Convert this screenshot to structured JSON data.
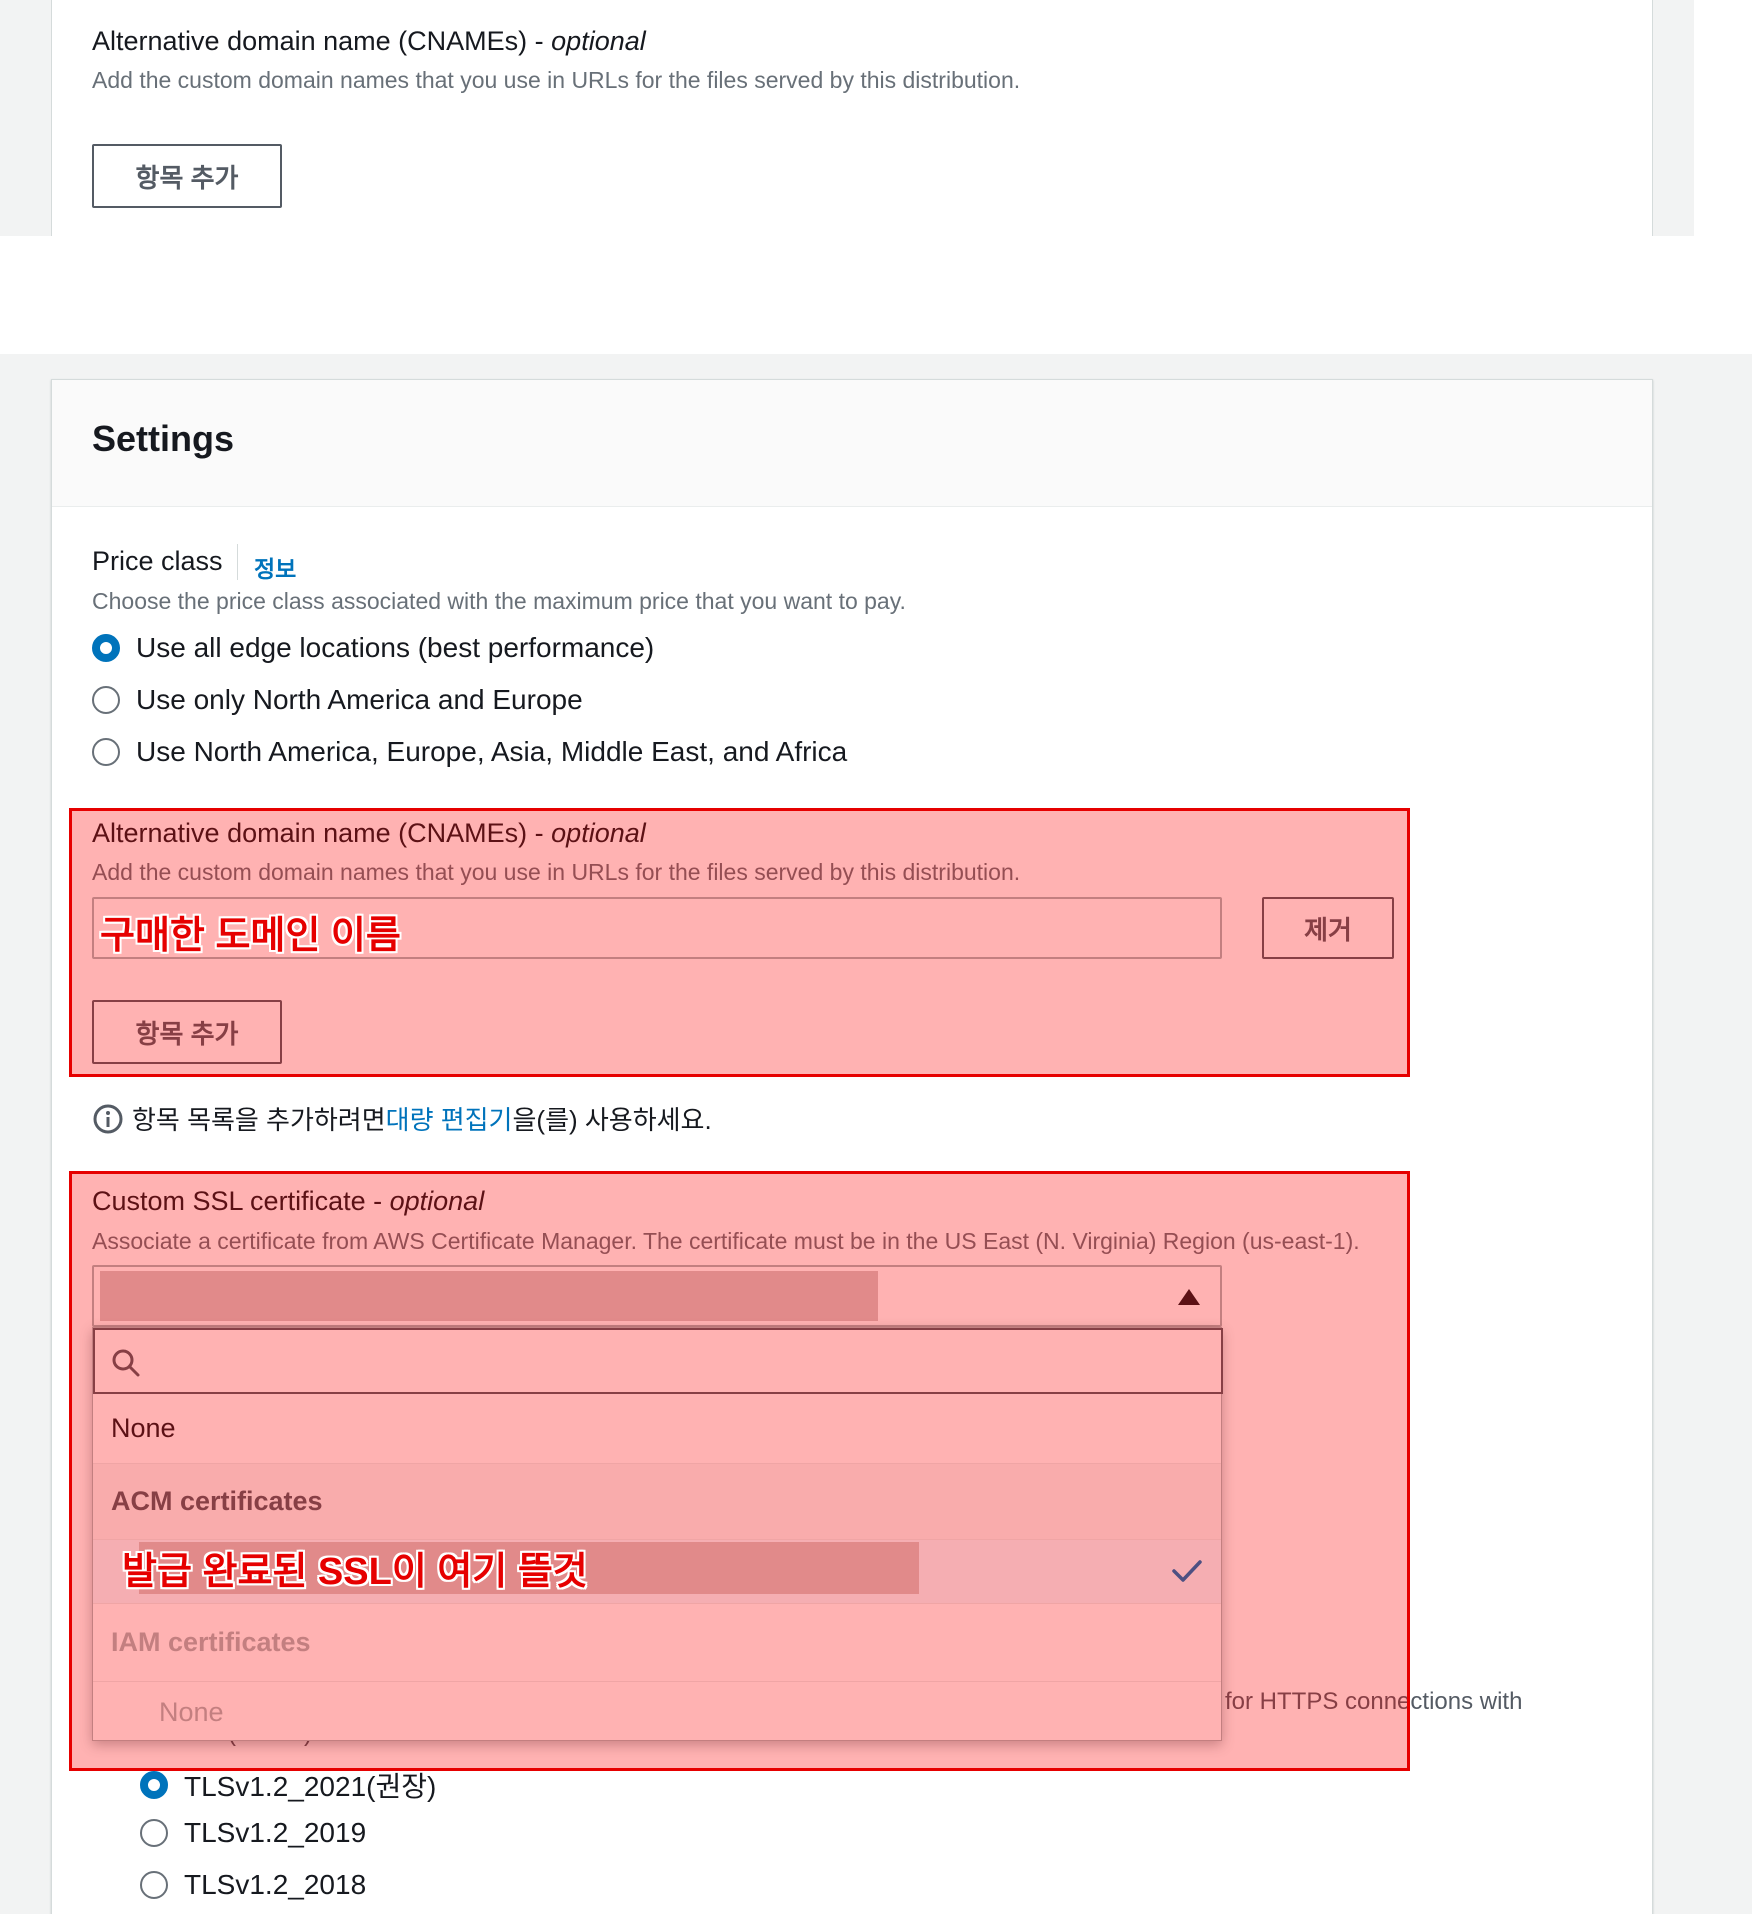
{
  "top_section": {
    "cname_label": "Alternative domain name (CNAMEs)",
    "cname_label_sep": " - ",
    "cname_optional": "optional",
    "cname_description": "Add the custom domain names that you use in URLs for the files served by this distribution.",
    "add_item_button": "항목 추가"
  },
  "settings": {
    "title": "Settings",
    "price_class": {
      "label": "Price class",
      "info_link": "정보",
      "description": "Choose the price class associated with the maximum price that you want to pay.",
      "options": [
        "Use all edge locations (best performance)",
        "Use only North America and Europe",
        "Use North America, Europe, Asia, Middle East, and Africa"
      ],
      "selected_index": 0
    },
    "cname": {
      "label": "Alternative domain name (CNAMEs)",
      "label_sep": " - ",
      "optional": "optional",
      "description": "Add the custom domain names that you use in URLs for the files served by this distribution.",
      "remove_button": "제거",
      "add_item_button": "항목 추가"
    },
    "bulk_hint": {
      "before": "항목 목록을 추가하려면 ",
      "link": "대량 편집기",
      "after": "을(를) 사용하세요."
    },
    "ssl": {
      "label": "Custom SSL certificate",
      "label_sep": " - ",
      "optional": "optional",
      "description": "Associate a certificate from AWS Certificate Manager. The certificate must be in the US East (N. Virginia) Region (us-east-1).",
      "search_placeholder": "",
      "dropdown": {
        "none_option": "None",
        "acm_group": "ACM certificates",
        "iam_group": "IAM certificates",
        "iam_none": "None"
      }
    },
    "security_policy": {
      "partial_description": "for HTTPS connections with",
      "partial_second_line": "viewers (clients).",
      "options": [
        "TLSv1.2_2021(권장)",
        "TLSv1.2_2019",
        "TLSv1.2_2018"
      ],
      "selected_index": 0
    }
  },
  "annotations": {
    "domain_name": "구매한 도메인 이름",
    "ssl_appears_here": "발급 완료된 SSL이 여기 뜰것"
  },
  "colors": {
    "link": "#0073bb",
    "annotation_red": "#e60000",
    "radio_selected": "#0073bb"
  }
}
